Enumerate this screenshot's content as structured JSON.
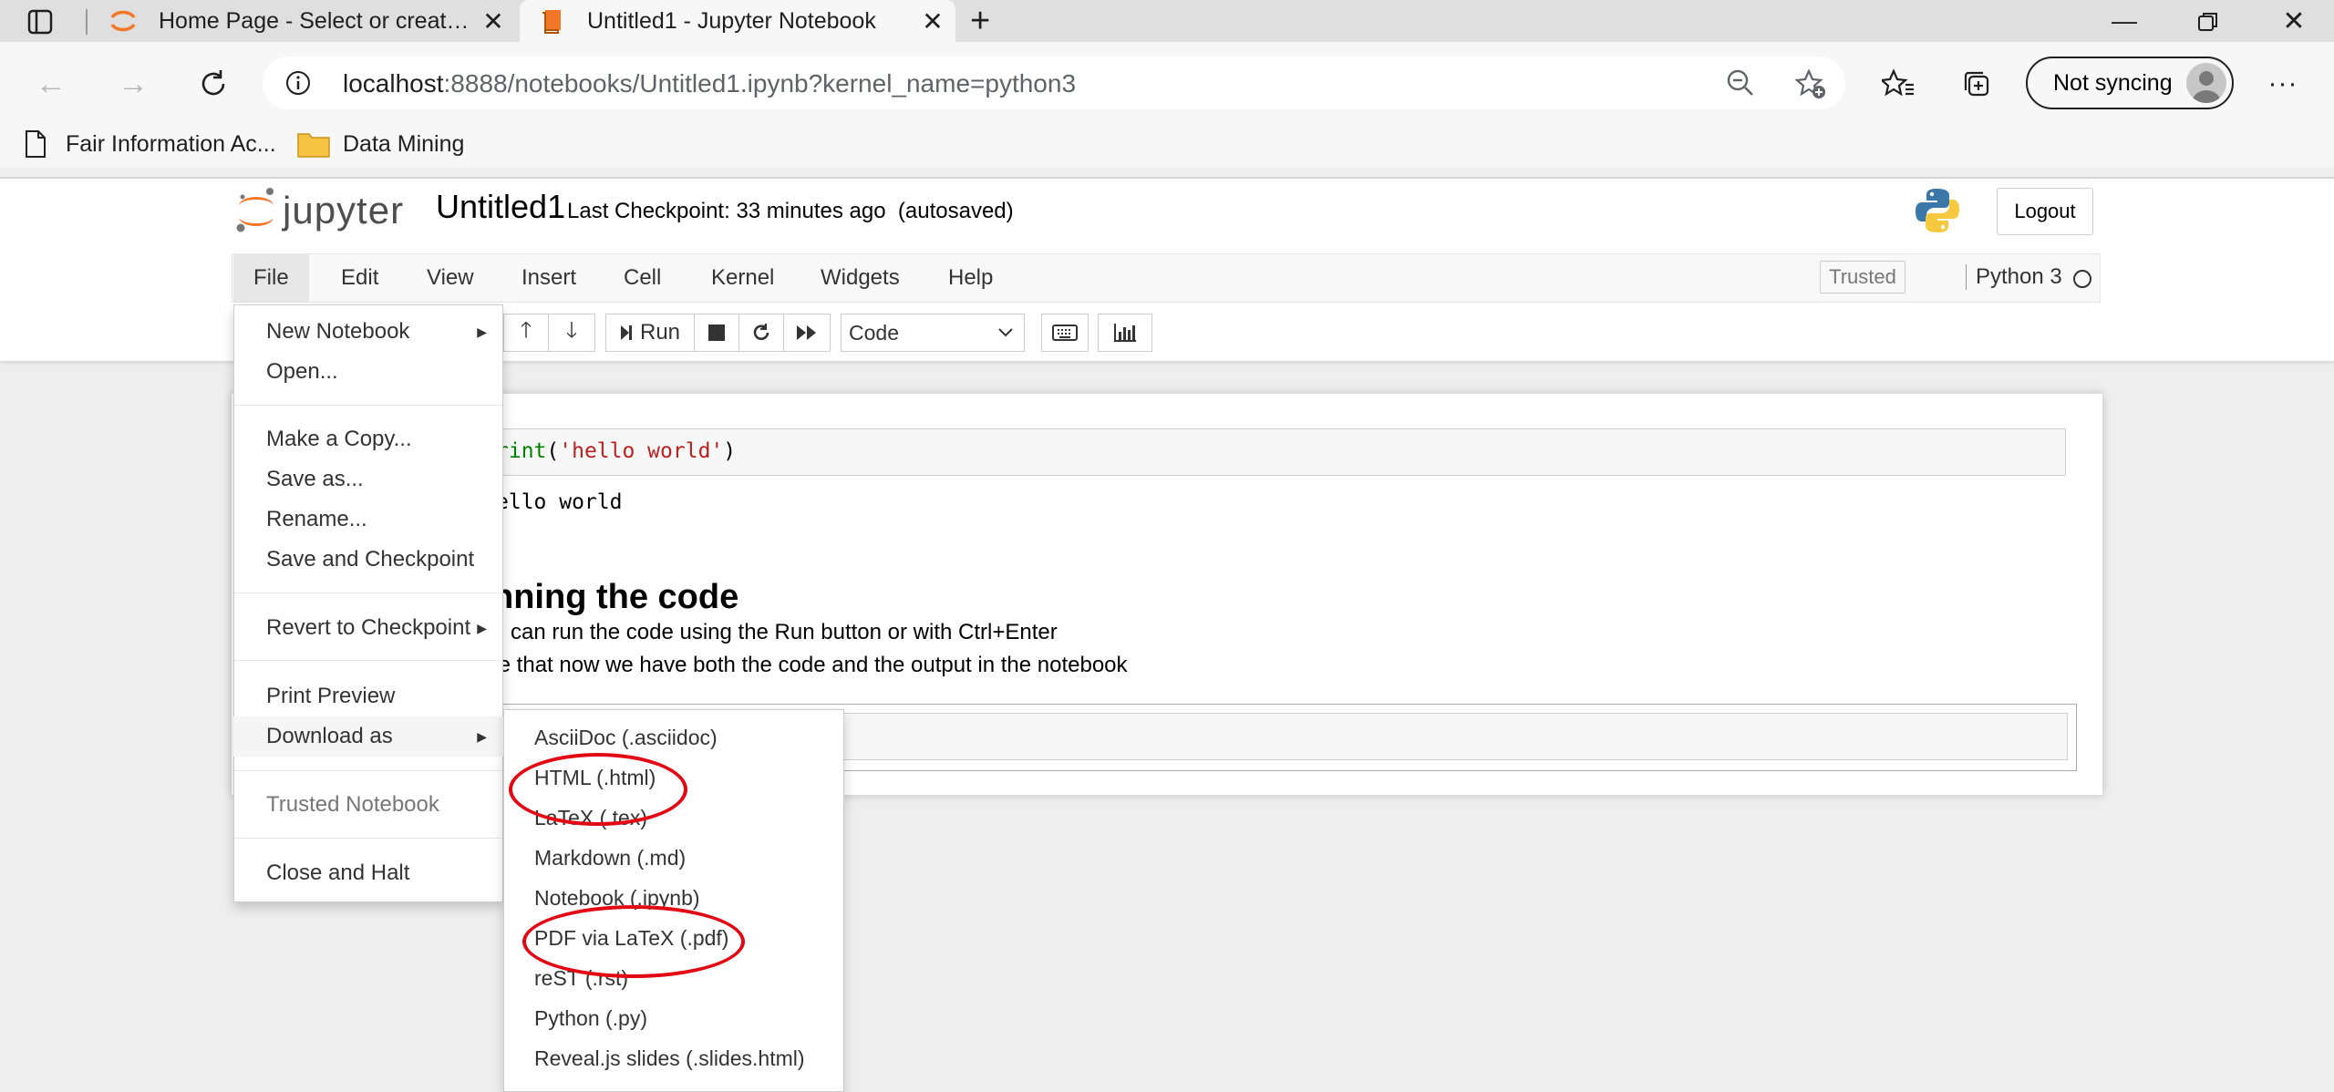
{
  "browser": {
    "tabs": [
      {
        "title": "Home Page - Select or create a n",
        "active": false
      },
      {
        "title": "Untitled1 - Jupyter Notebook",
        "active": true
      }
    ],
    "url": {
      "host": "localhost",
      "path": ":8888/notebooks/Untitled1.ipynb?kernel_name=python3"
    },
    "sync_label": "Not syncing",
    "bookmarks": [
      {
        "label": "Fair Information Ac...",
        "icon": "page-icon"
      },
      {
        "label": "Data Mining",
        "icon": "folder-icon"
      }
    ]
  },
  "jupyter": {
    "logo_text": "jupyter",
    "notebook_title": "Untitled1",
    "checkpoint": "Last Checkpoint: 33 minutes ago",
    "autosave": "(autosaved)",
    "logout_label": "Logout",
    "menus": [
      "File",
      "Edit",
      "View",
      "Insert",
      "Cell",
      "Kernel",
      "Widgets",
      "Help"
    ],
    "trusted_label": "Trusted",
    "kernel_label": "Python 3",
    "toolbar": {
      "run_label": "Run",
      "cell_type": "Code"
    }
  },
  "notebook": {
    "code_cell": {
      "print_kw": "rint",
      "paren_open": "(",
      "string": "'hello world'",
      "paren_close": ")"
    },
    "output": "ello world",
    "markdown": {
      "heading": "nning the code",
      "line1": "u can run the code using the Run button or with Ctrl+Enter",
      "line2": "te that now we have both the code and the output in the notebook"
    }
  },
  "file_menu": {
    "items": {
      "new_notebook": "New Notebook",
      "open": "Open...",
      "make_copy": "Make a Copy...",
      "save_as": "Save as...",
      "rename": "Rename...",
      "save_checkpoint": "Save and Checkpoint",
      "revert": "Revert to Checkpoint",
      "print_preview": "Print Preview",
      "download_as": "Download as",
      "trusted_notebook": "Trusted Notebook",
      "close_halt": "Close and Halt"
    }
  },
  "download_menu": {
    "items": [
      "AsciiDoc (.asciidoc)",
      "HTML (.html)",
      "LaTeX (.tex)",
      "Markdown (.md)",
      "Notebook (.ipynb)",
      "PDF via LaTeX (.pdf)",
      "reST (.rst)",
      "Python (.py)",
      "Reveal.js slides (.slides.html)"
    ],
    "highlighted": [
      "HTML (.html)",
      "PDF via LaTeX (.pdf)"
    ]
  },
  "colors": {
    "annotation": "#e30613",
    "jupyter_orange": "#f37726"
  }
}
